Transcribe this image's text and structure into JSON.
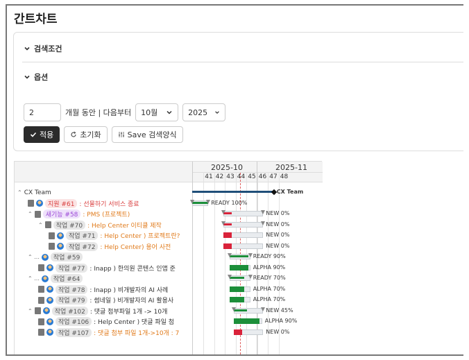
{
  "page_title": "간트차트",
  "search_section": "검색조건",
  "options_section": "옵션",
  "options": {
    "months_value": "2",
    "months_text": "개월 동안 | 다음부터",
    "month_select": "10월",
    "year_select": "2025"
  },
  "buttons": {
    "apply": "적용",
    "reset": "초기화",
    "save": "Save 검색양식"
  },
  "gantt": {
    "months": [
      "2025-10",
      "2025-11"
    ],
    "weeks": [
      "41",
      "42",
      "43",
      "44",
      "45",
      "46",
      "47",
      "48"
    ],
    "rows": [
      {
        "toggle": "⌃",
        "badge": "",
        "badgeColor": "",
        "title": "CX Team",
        "titleColor": "dark",
        "doc": false,
        "avatar": false,
        "indent": 0
      },
      {
        "toggle": "",
        "badge": "지원 #61",
        "badgeColor": "red",
        "title": ": 선물하기 서비스 종료",
        "titleColor": "red",
        "doc": true,
        "avatar": true,
        "indent": 1
      },
      {
        "toggle": "⌃",
        "badge": "새기능 #58",
        "badgeColor": "purple",
        "title": ": PMS (프로젝트)",
        "titleColor": "orange",
        "doc": true,
        "avatar": false,
        "indent": 1
      },
      {
        "toggle": "⌃",
        "badge": "작업 #70",
        "badgeColor": "gray",
        "title": ": Help Center 이티클 제작",
        "titleColor": "orange",
        "doc": true,
        "avatar": false,
        "indent": 2
      },
      {
        "toggle": "",
        "badge": "작업 #71",
        "badgeColor": "gray",
        "title": ": Help Center ) 프로젝트란?",
        "titleColor": "orange",
        "doc": true,
        "avatar": true,
        "indent": 3
      },
      {
        "toggle": "",
        "badge": "작업 #72",
        "badgeColor": "gray",
        "title": ": Help Center) 용어 사전",
        "titleColor": "orange",
        "doc": true,
        "avatar": true,
        "indent": 3
      },
      {
        "toggle": "⌃ ...",
        "badge": "작업 #59",
        "badgeColor": "gray",
        "title": "",
        "titleColor": "dark",
        "doc": false,
        "avatar": true,
        "indent": 1
      },
      {
        "toggle": "",
        "badge": "작업 #77",
        "badgeColor": "gray",
        "title": ": Inapp ) 한의원 콘텐스 인앱 준",
        "titleColor": "dark",
        "doc": true,
        "avatar": true,
        "indent": 2
      },
      {
        "toggle": "⌃ ...",
        "badge": "작업 #64",
        "badgeColor": "gray",
        "title": "",
        "titleColor": "dark",
        "doc": false,
        "avatar": true,
        "indent": 1
      },
      {
        "toggle": "",
        "badge": "작업 #78",
        "badgeColor": "gray",
        "title": ": Inapp ) 비개발자의 AI 사례",
        "titleColor": "dark",
        "doc": true,
        "avatar": true,
        "indent": 2
      },
      {
        "toggle": "",
        "badge": "작업 #79",
        "badgeColor": "gray",
        "title": ": 썸네일 ) 비개발자의 AI 활용사",
        "titleColor": "dark",
        "doc": true,
        "avatar": true,
        "indent": 2
      },
      {
        "toggle": "⌃",
        "badge": "작업 #102",
        "badgeColor": "gray",
        "title": ": 댓글 첨부파일 1개 -> 10개",
        "titleColor": "dark",
        "doc": true,
        "avatar": true,
        "indent": 1
      },
      {
        "toggle": "",
        "badge": "작업 #106",
        "badgeColor": "gray",
        "title": ": Help Center ) 댓글 파일 첨",
        "titleColor": "dark",
        "doc": true,
        "avatar": true,
        "indent": 2
      },
      {
        "toggle": "",
        "badge": "작업 #107",
        "badgeColor": "gray",
        "title": ": 댓글 첨부 파일 1개->10개 : 7",
        "titleColor": "orange",
        "doc": true,
        "avatar": true,
        "indent": 2
      }
    ],
    "bars": [
      {
        "kind": "group",
        "start": 0.0,
        "end": 7.6,
        "progress": 1.0,
        "label": "CX Team",
        "milestones": true
      },
      {
        "kind": "task",
        "start": 0.0,
        "end": 1.5,
        "progress": 1.0,
        "label": "READY 100%",
        "milestones": true,
        "color": "#1c8f3a"
      },
      {
        "kind": "task",
        "start": 2.9,
        "end": 6.6,
        "progress": 0.0,
        "label": "NEW 0%",
        "milestones": true,
        "color": "#d9223a"
      },
      {
        "kind": "task",
        "start": 2.9,
        "end": 6.6,
        "progress": 0.0,
        "label": "NEW 0%",
        "milestones": true,
        "color": "#d9223a"
      },
      {
        "kind": "task",
        "start": 2.9,
        "end": 6.6,
        "progress": 0.0,
        "label": "NEW 0%",
        "milestones": false,
        "color": "#d9223a"
      },
      {
        "kind": "task",
        "start": 2.9,
        "end": 6.6,
        "progress": 0.0,
        "label": "NEW 0%",
        "milestones": false,
        "color": "#d9223a"
      },
      {
        "kind": "task",
        "start": 3.5,
        "end": 5.4,
        "progress": 0.9,
        "label": "READY 90%",
        "milestones": true,
        "color": "#1c8f3a"
      },
      {
        "kind": "task",
        "start": 3.5,
        "end": 5.4,
        "progress": 0.9,
        "label": "ALPHA 90%",
        "milestones": false,
        "color": "#1c8f3a"
      },
      {
        "kind": "task",
        "start": 3.5,
        "end": 5.4,
        "progress": 0.7,
        "label": "READY 70%",
        "milestones": true,
        "color": "#1c8f3a"
      },
      {
        "kind": "task",
        "start": 3.5,
        "end": 5.4,
        "progress": 0.7,
        "label": "ALPHA 70%",
        "milestones": false,
        "color": "#1c8f3a"
      },
      {
        "kind": "task",
        "start": 3.5,
        "end": 5.4,
        "progress": 0.7,
        "label": "ALPHA 70%",
        "milestones": false,
        "color": "#1c8f3a"
      },
      {
        "kind": "task",
        "start": 3.9,
        "end": 6.6,
        "progress": 0.45,
        "label": "NEW 45%",
        "milestones": true,
        "color": "#1c8f3a"
      },
      {
        "kind": "task",
        "start": 3.9,
        "end": 6.5,
        "progress": 0.9,
        "label": "ALPHA 90%",
        "milestones": false,
        "color": "#1c8f3a"
      },
      {
        "kind": "task",
        "start": 3.9,
        "end": 6.6,
        "progress": 0.0,
        "label": "NEW 0%",
        "milestones": false,
        "color": "#d9223a"
      }
    ]
  }
}
